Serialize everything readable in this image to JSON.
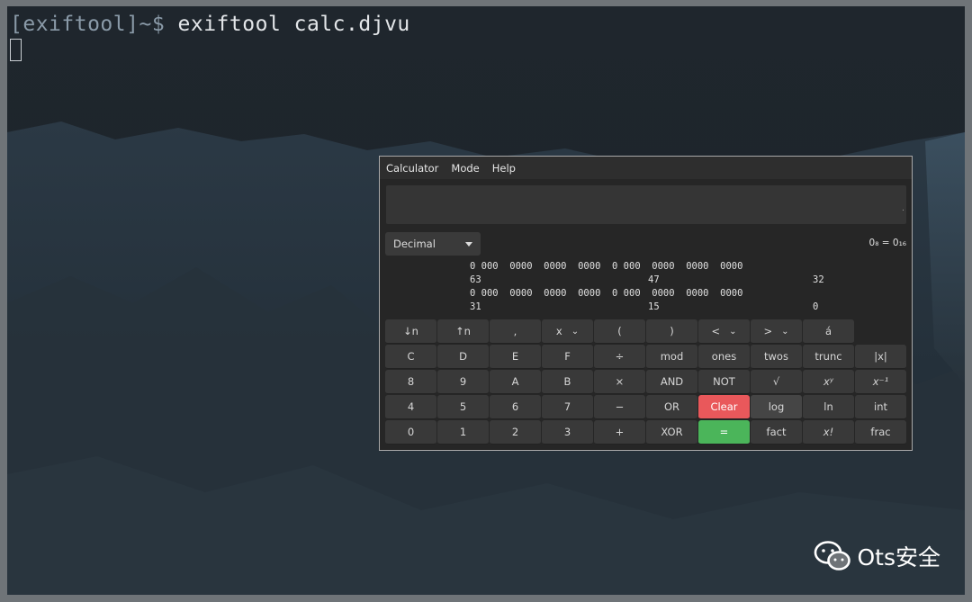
{
  "terminal": {
    "prompt": "[exiftool]~$",
    "command": " exiftool calc.djvu"
  },
  "calculator": {
    "menu": [
      "Calculator",
      "Mode",
      "Help"
    ],
    "display_value": "",
    "base": "Decimal",
    "conversion": "0₈ = 0₁₆",
    "bits": {
      "row1": "0 000  0000  0000  0000  0 000  0000  0000  0000",
      "row1_labels": [
        "63",
        "47",
        "32"
      ],
      "row2": "0 000  0000  0000  0000  0 000  0000  0000  0000",
      "row2_labels": [
        "31",
        "15",
        "0"
      ]
    },
    "keys": {
      "r0": [
        "↓n",
        "↑n",
        ",",
        "x",
        "(",
        ")",
        "<",
        ">",
        "á"
      ],
      "r1": [
        "C",
        "D",
        "E",
        "F",
        "÷",
        "mod",
        "ones",
        "twos",
        "trunc",
        "|x|"
      ],
      "r2": [
        "8",
        "9",
        "A",
        "B",
        "×",
        "AND",
        "NOT",
        "√",
        "xʸ",
        "x⁻¹"
      ],
      "r3": [
        "4",
        "5",
        "6",
        "7",
        "−",
        "OR",
        "Clear",
        "log",
        "ln",
        "int"
      ],
      "r4": [
        "0",
        "1",
        "2",
        "3",
        "+",
        "XOR",
        "=",
        "fact",
        "x!",
        "frac"
      ]
    },
    "colors": {
      "clear": "#e9585b",
      "equals": "#4bb55a"
    }
  },
  "watermark": {
    "text": "Ots安全",
    "icon": "wechat-icon"
  }
}
